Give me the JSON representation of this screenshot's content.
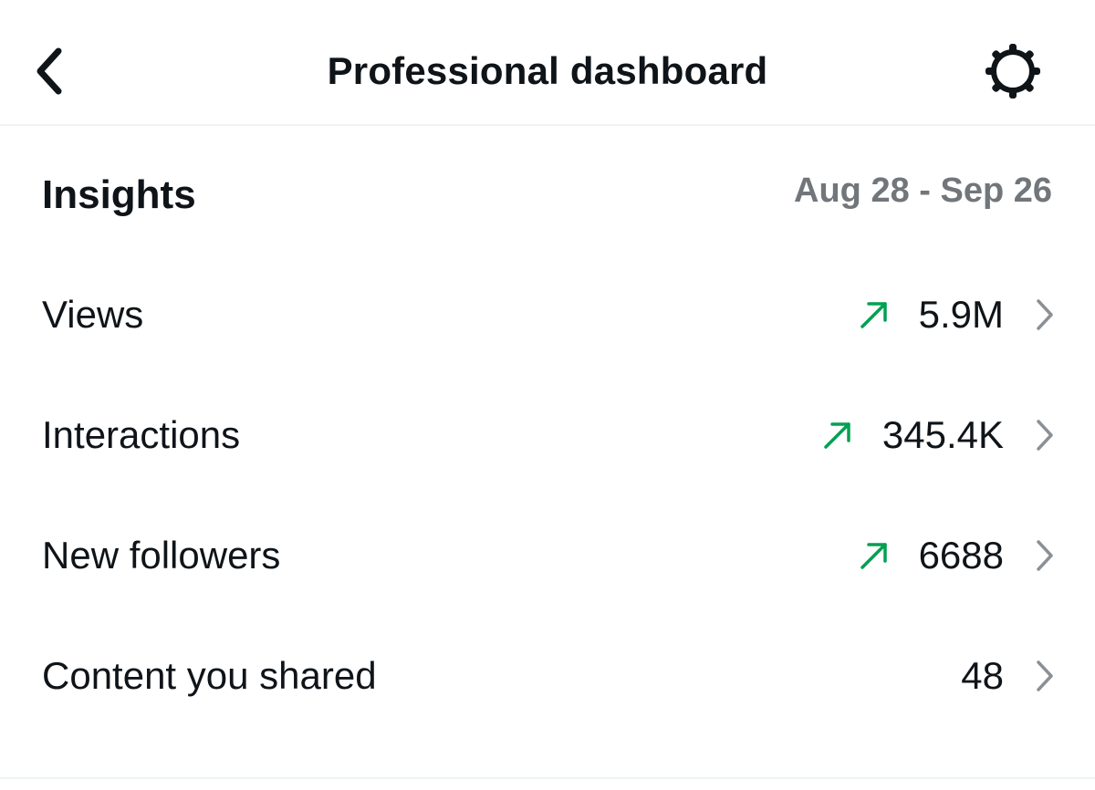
{
  "header": {
    "title": "Professional dashboard",
    "back_icon": "chevron-left-icon",
    "settings_icon": "gear-icon"
  },
  "insights": {
    "title": "Insights",
    "date_range": "Aug 28 - Sep 26"
  },
  "colors": {
    "text": "#0f1419",
    "secondary": "#71767b",
    "trend_up": "#00a151",
    "chevron": "#8b9095"
  },
  "metrics": [
    {
      "label": "Views",
      "value": "5.9M",
      "trend": "up"
    },
    {
      "label": "Interactions",
      "value": "345.4K",
      "trend": "up"
    },
    {
      "label": "New followers",
      "value": "6688",
      "trend": "up"
    },
    {
      "label": "Content you shared",
      "value": "48",
      "trend": "none"
    }
  ]
}
